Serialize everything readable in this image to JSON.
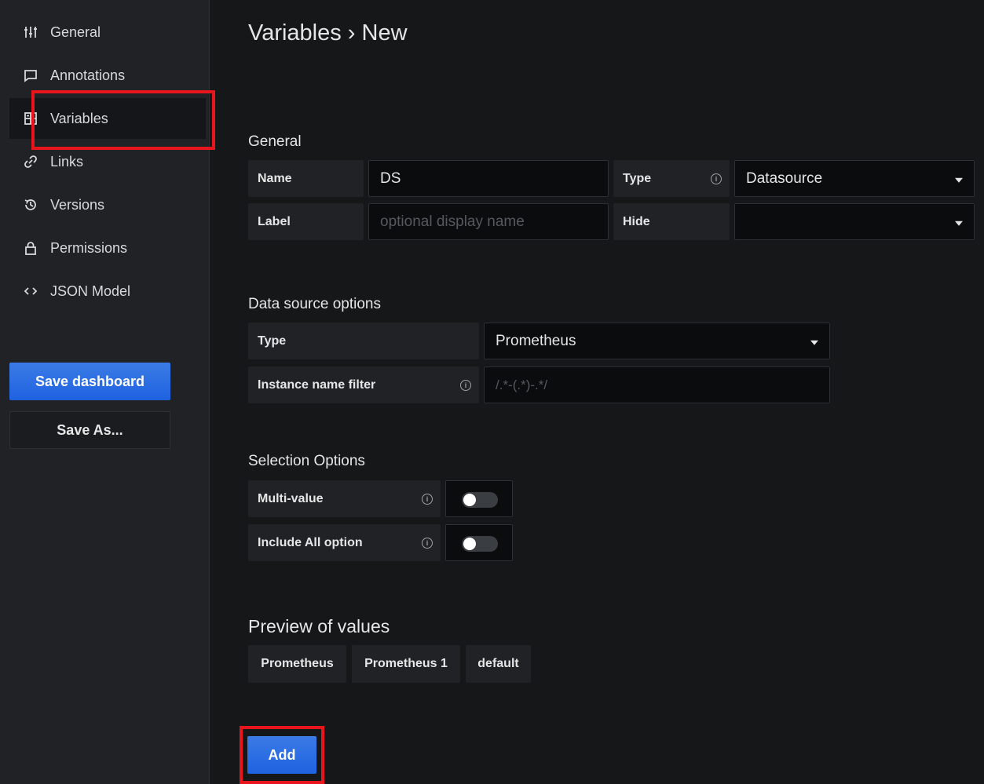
{
  "sidebar": {
    "items": [
      {
        "label": "General",
        "icon": "sliders-icon"
      },
      {
        "label": "Annotations",
        "icon": "comment-icon"
      },
      {
        "label": "Variables",
        "icon": "calculator-icon",
        "active": true
      },
      {
        "label": "Links",
        "icon": "link-icon"
      },
      {
        "label": "Versions",
        "icon": "history-icon"
      },
      {
        "label": "Permissions",
        "icon": "lock-icon"
      },
      {
        "label": "JSON Model",
        "icon": "code-icon"
      }
    ],
    "save_dashboard": "Save dashboard",
    "save_as": "Save As..."
  },
  "main": {
    "title": "Variables › New",
    "general": {
      "heading": "General",
      "name_label": "Name",
      "name_value": "DS",
      "type_label": "Type",
      "type_value": "Datasource",
      "label_label": "Label",
      "label_placeholder": "optional display name",
      "hide_label": "Hide",
      "hide_value": ""
    },
    "datasource": {
      "heading": "Data source options",
      "type_label": "Type",
      "type_value": "Prometheus",
      "filter_label": "Instance name filter",
      "filter_placeholder": "/.*-(.*)-.*/"
    },
    "selection": {
      "heading": "Selection Options",
      "multi_label": "Multi-value",
      "multi_on": false,
      "include_all_label": "Include All option",
      "include_all_on": false
    },
    "preview": {
      "heading": "Preview of values",
      "values": [
        "Prometheus",
        "Prometheus 1",
        "default"
      ]
    },
    "add_button": "Add"
  },
  "colors": {
    "accent": "#1f62e0",
    "highlight": "#e8161c",
    "background": "#161719",
    "sidebar": "#202226"
  }
}
